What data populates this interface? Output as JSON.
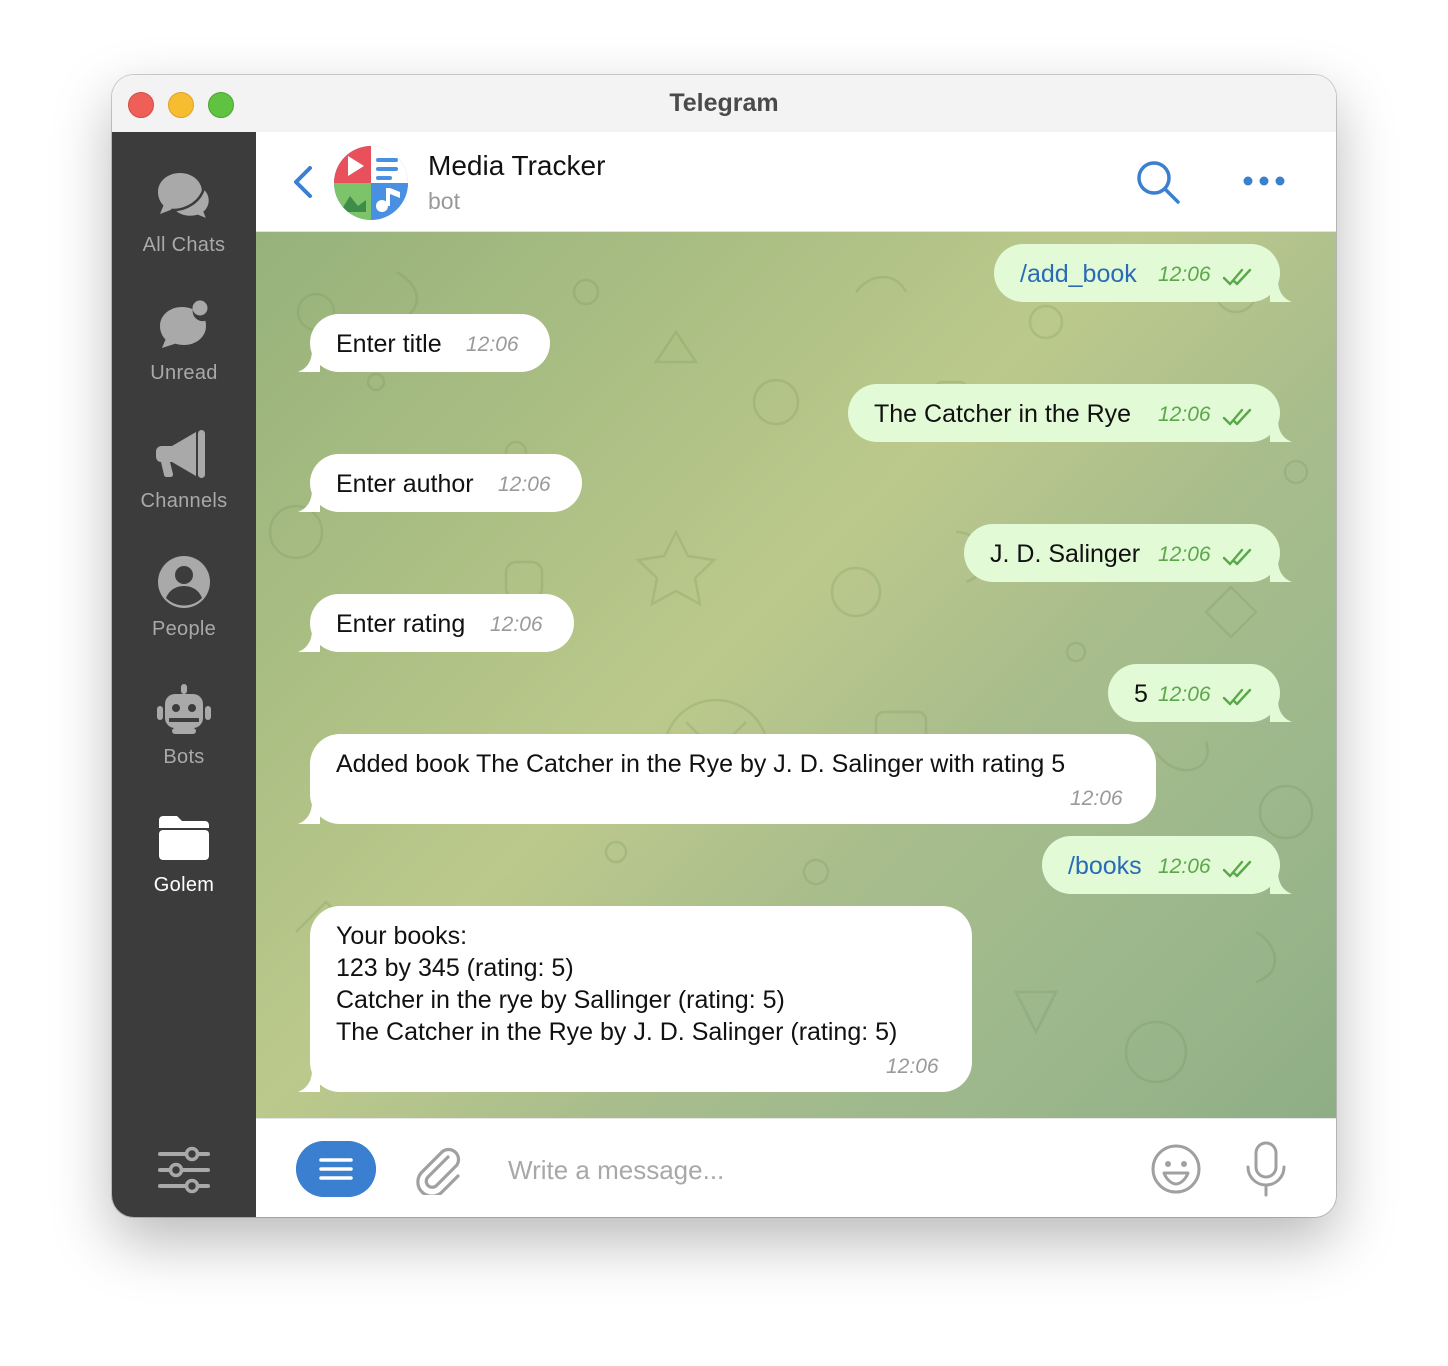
{
  "window": {
    "title": "Telegram"
  },
  "sidebar": {
    "items": [
      {
        "label": "All Chats",
        "icon": "chats-icon",
        "active": false
      },
      {
        "label": "Unread",
        "icon": "unread-icon",
        "active": false
      },
      {
        "label": "Channels",
        "icon": "megaphone-icon",
        "active": false
      },
      {
        "label": "People",
        "icon": "person-icon",
        "active": false
      },
      {
        "label": "Bots",
        "icon": "robot-icon",
        "active": false
      },
      {
        "label": "Golem",
        "icon": "folder-icon",
        "active": true
      }
    ],
    "settings_icon": "sliders-icon"
  },
  "header": {
    "chat_name": "Media Tracker",
    "chat_status": "bot"
  },
  "messages": [
    {
      "dir": "out",
      "text": "/add_book",
      "time": "12:06",
      "command": true,
      "read": true
    },
    {
      "dir": "in",
      "text": "Enter title",
      "time": "12:06"
    },
    {
      "dir": "out",
      "text": "The Catcher in the Rye",
      "time": "12:06",
      "read": true
    },
    {
      "dir": "in",
      "text": "Enter author",
      "time": "12:06"
    },
    {
      "dir": "out",
      "text": "J. D. Salinger",
      "time": "12:06",
      "read": true
    },
    {
      "dir": "in",
      "text": "Enter rating",
      "time": "12:06"
    },
    {
      "dir": "out",
      "text": "5",
      "time": "12:06",
      "read": true
    },
    {
      "dir": "in",
      "text": "Added book The Catcher in the Rye by J. D. Salinger with rating 5",
      "time": "12:06"
    },
    {
      "dir": "out",
      "text": "/books",
      "time": "12:06",
      "command": true,
      "read": true
    },
    {
      "dir": "in",
      "text": "Your books:\n123 by 345 (rating: 5)\nCatcher in the rye by Sallinger (rating: 5)\nThe Catcher in the Rye by J. D. Salinger (rating: 5)",
      "time": "12:06"
    }
  ],
  "composer": {
    "placeholder": "Write a message..."
  },
  "colors": {
    "accent": "#3a7fd0",
    "outgoing_bubble": "#e2fad5",
    "incoming_bubble": "#ffffff",
    "sidebar": "#3c3c3c",
    "read_check": "#5aa84a"
  }
}
